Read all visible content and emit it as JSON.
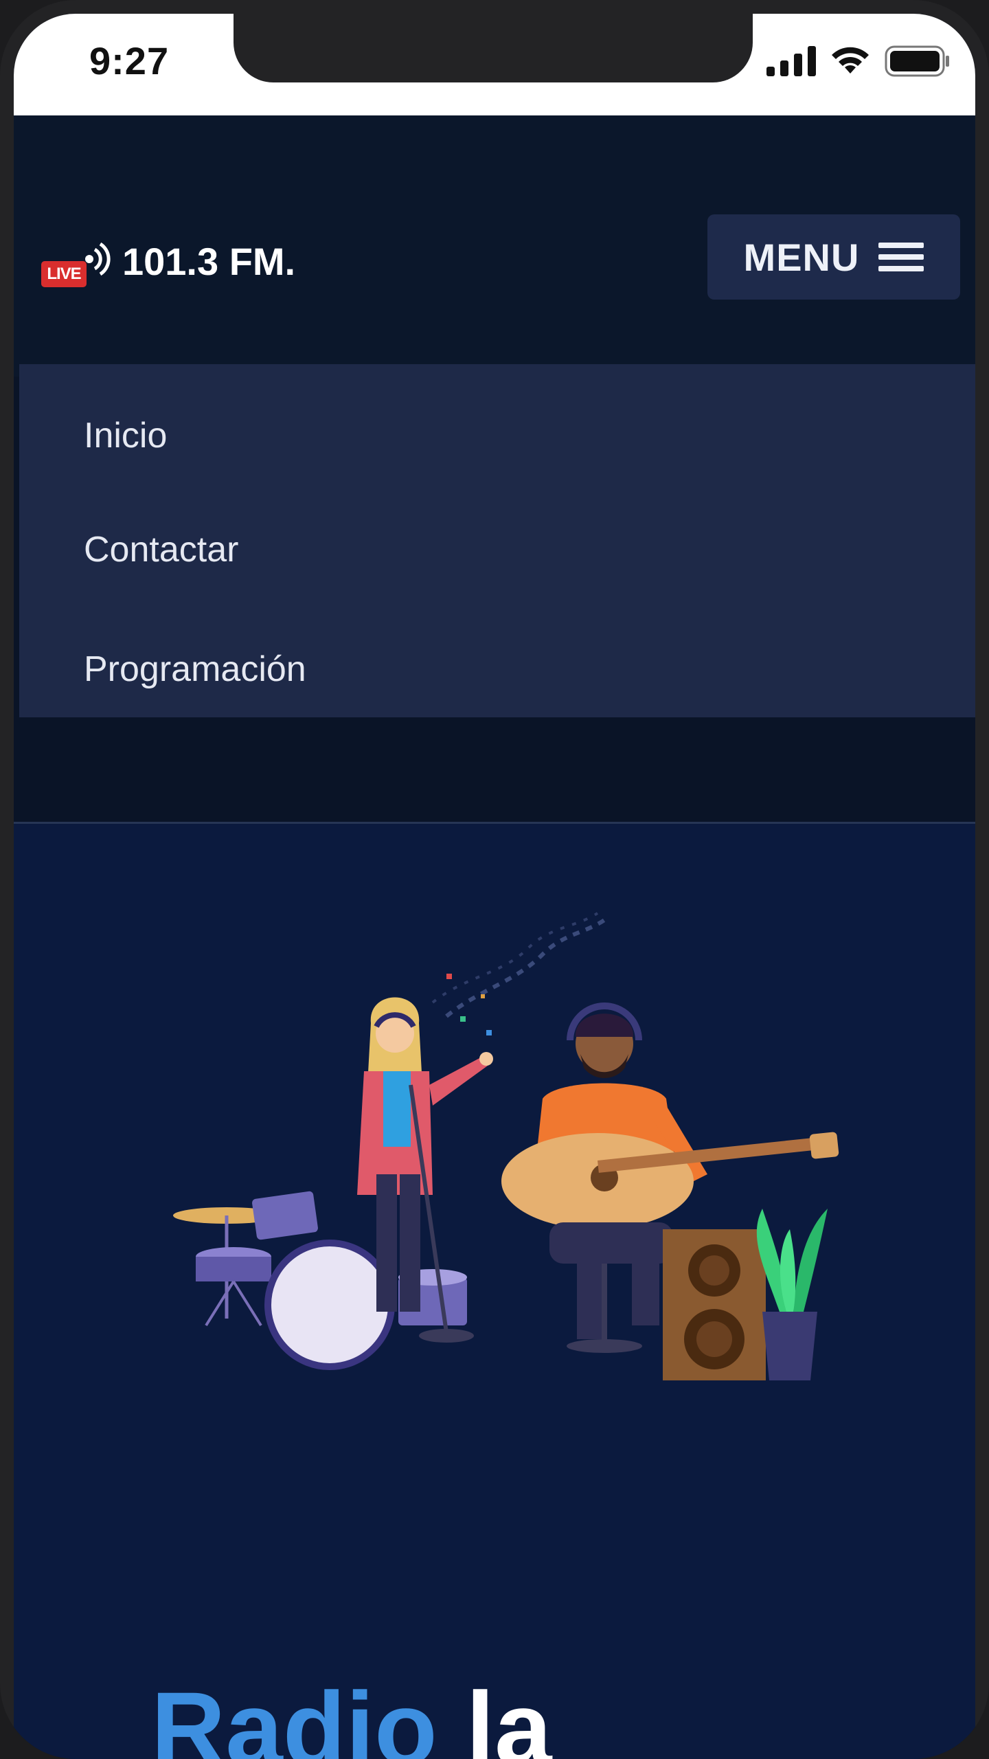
{
  "status_bar": {
    "time": "9:27",
    "icons": [
      "cellular-signal-icon",
      "wifi-icon",
      "battery-icon"
    ]
  },
  "header": {
    "logo": {
      "badge": "LIVE",
      "text": "101.3 FM.",
      "icon": "broadcast-signal-icon"
    },
    "menu_button": {
      "label": "MENU",
      "icon": "hamburger-icon"
    }
  },
  "nav": {
    "items": [
      {
        "label": "Inicio"
      },
      {
        "label": "Contactar"
      },
      {
        "label": "Programación"
      }
    ]
  },
  "hero": {
    "illustration": "musicians-illustration",
    "title_part1": "Radio",
    "title_part2": "la"
  },
  "colors": {
    "header_bg": "#0b172b",
    "menu_bg": "#1e2948",
    "hero_bg": "#0b1a3e",
    "accent_blue": "#3d8fe0",
    "live_red": "#d92e2e"
  }
}
